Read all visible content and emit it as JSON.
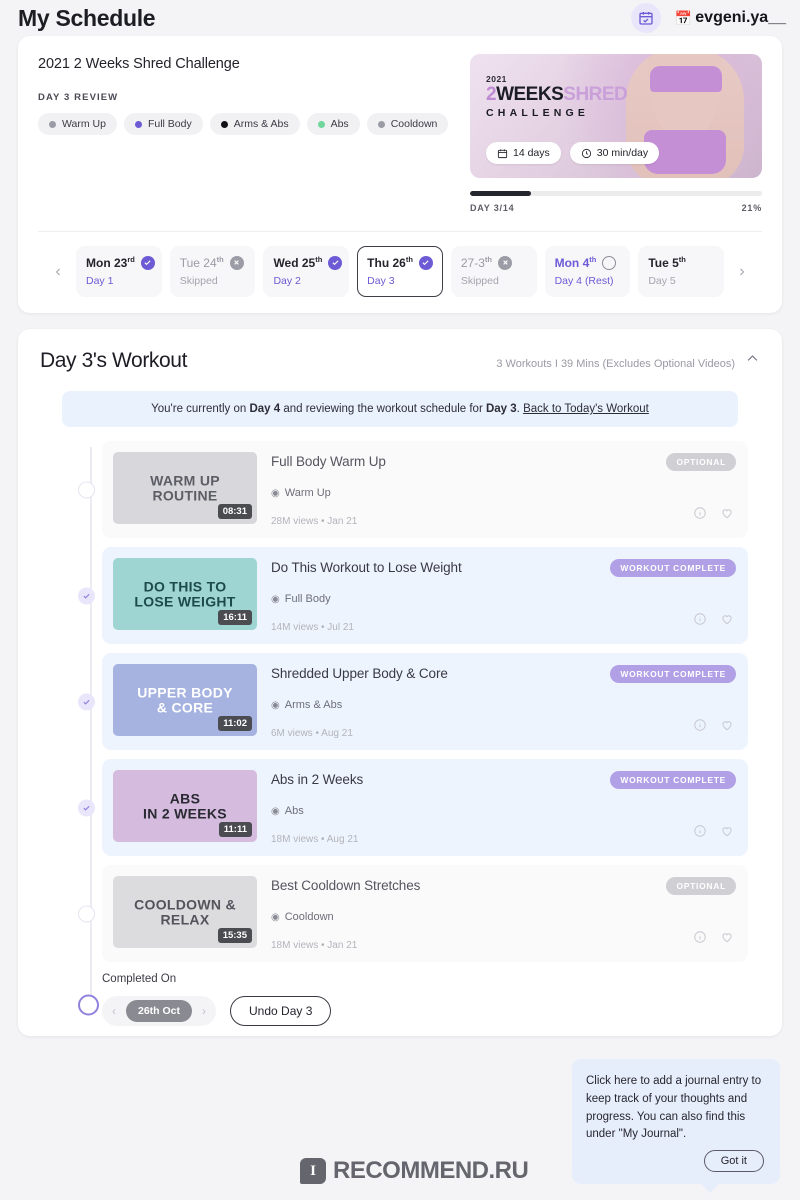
{
  "header": {
    "title": "My Schedule",
    "calendar_icon": "calendar-check-icon",
    "user_icon": "calendar-icon",
    "username": "evgeni.ya__"
  },
  "challenge": {
    "title": "2021 2 Weeks Shred Challenge",
    "subtitle": "DAY 3 REVIEW",
    "tags": [
      {
        "label": "Warm Up",
        "color": "#9b9ba6"
      },
      {
        "label": "Full Body",
        "color": "#6c5bd4"
      },
      {
        "label": "Arms & Abs",
        "color": "#111118"
      },
      {
        "label": "Abs",
        "color": "#6fd79b"
      },
      {
        "label": "Cooldown",
        "color": "#9b9ba6"
      }
    ],
    "hero": {
      "year": "2021",
      "line1_a": "2",
      "line1_b": "WEEKS",
      "line1_c": "SHRED",
      "line2": "CHALLENGE",
      "pill_days": "14 days",
      "pill_duration": "30 min/day"
    },
    "progress": {
      "label": "DAY 3/14",
      "percent_label": "21%",
      "percent": 21,
      "fill_color": "#26262e"
    },
    "collapse_icon": "chevron-up-icon"
  },
  "days": {
    "prev_icon": "chevron-left-icon",
    "next_icon": "chevron-right-icon",
    "items": [
      {
        "name": "Mon 23",
        "ord": "rd",
        "label": "Day 1",
        "state": "done",
        "selected": false
      },
      {
        "name": "Tue 24",
        "ord": "th",
        "label": "Skipped",
        "state": "skipped",
        "selected": false
      },
      {
        "name": "Wed 25",
        "ord": "th",
        "label": "Day 2",
        "state": "done",
        "selected": false
      },
      {
        "name": "Thu 26",
        "ord": "th",
        "label": "Day 3",
        "state": "done",
        "selected": true
      },
      {
        "name": "27-3",
        "ord": "th",
        "label": "Skipped",
        "state": "skipped",
        "selected": false
      },
      {
        "name": "Mon 4",
        "ord": "th",
        "label": "Day 4 (Rest)",
        "state": "open",
        "selected": false
      },
      {
        "name": "Tue 5",
        "ord": "th",
        "label": "Day 5",
        "state": "none",
        "selected": false
      }
    ]
  },
  "workout": {
    "title": "Day 3's Workout",
    "meta": "3 Workouts I 39 Mins (Excludes Optional Videos)",
    "collapse_icon": "chevron-up-icon",
    "notice": {
      "part1": "You're currently on ",
      "bold1": "Day 4",
      "part2": " and reviewing the workout schedule for ",
      "bold2": "Day 3",
      "part3": ". ",
      "link": "Back to Today's Workout"
    },
    "items": [
      {
        "title": "Full Body Warm Up",
        "category": "Warm Up",
        "stats": "28M views • Jan 21",
        "duration": "08:31",
        "badge": "OPTIONAL",
        "badge_type": "optional",
        "state": "open",
        "thumb_label": "WARM UP\nROUTINE",
        "thumb_bg": "#d8d8dc",
        "thumb_text_color": "#5d5d66"
      },
      {
        "title": "Do This Workout to Lose Weight",
        "category": "Full Body",
        "stats": "14M views • Jul 21",
        "duration": "16:11",
        "badge": "WORKOUT COMPLETE",
        "badge_type": "complete",
        "state": "done",
        "thumb_label": "DO THIS TO\nLOSE WEIGHT",
        "thumb_bg": "#9ed4d2",
        "thumb_text_color": "#1d4b4a"
      },
      {
        "title": "Shredded Upper Body & Core",
        "category": "Arms & Abs",
        "stats": "6M views • Aug 21",
        "duration": "11:02",
        "badge": "WORKOUT COMPLETE",
        "badge_type": "complete",
        "state": "done",
        "thumb_label": "UPPER BODY\n& CORE",
        "thumb_bg": "#a6b2e0",
        "thumb_text_color": "#ffffff"
      },
      {
        "title": "Abs in 2 Weeks",
        "category": "Abs",
        "stats": "18M views • Aug 21",
        "duration": "11:11",
        "badge": "WORKOUT COMPLETE",
        "badge_type": "complete",
        "state": "done",
        "thumb_label": "ABS\nIN 2 WEEKS",
        "thumb_bg": "#d5bbdd",
        "thumb_text_color": "#2a2a33"
      },
      {
        "title": "Best Cooldown Stretches",
        "category": "Cooldown",
        "stats": "18M views • Jan 21",
        "duration": "15:35",
        "badge": "OPTIONAL",
        "badge_type": "optional",
        "state": "open",
        "thumb_label": "COOLDOWN & RELAX",
        "thumb_bg": "#dcdcdf",
        "thumb_text_color": "#53535c"
      }
    ],
    "completed": {
      "label": "Completed On",
      "date": "26th Oct",
      "prev_icon": "chevron-left-icon",
      "next_icon": "chevron-right-icon",
      "undo_label": "Undo Day 3"
    }
  },
  "tooltip": {
    "text": "Click here to add a journal entry to keep track of your thoughts and progress. You can also find this under \"My Journal\".",
    "button": "Got it"
  },
  "watermark": {
    "mark": "I",
    "text": "RECOMMEND.RU"
  }
}
